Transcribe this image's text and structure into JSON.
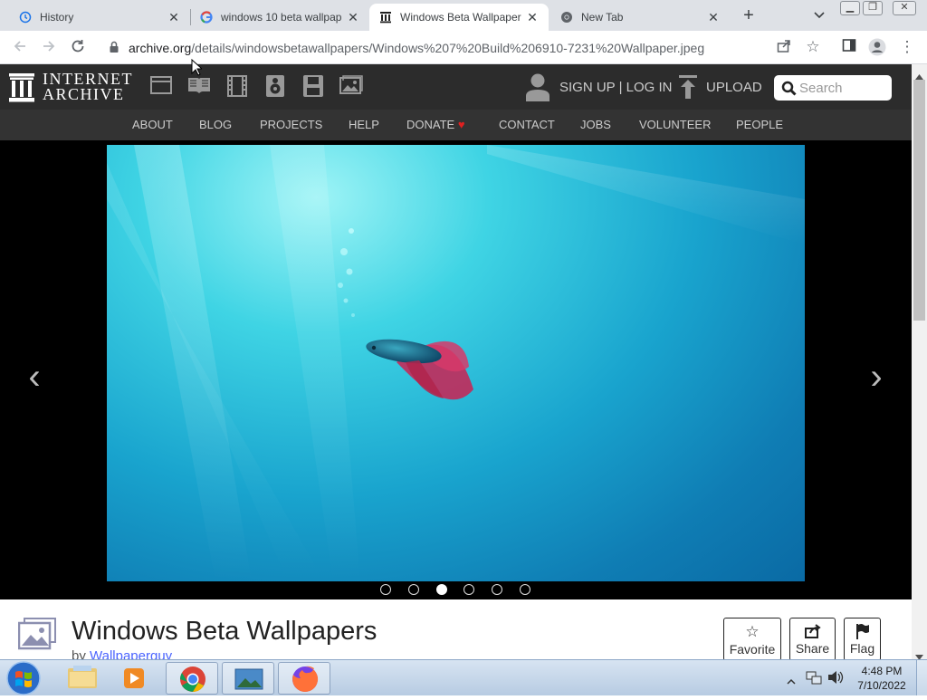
{
  "browser": {
    "tabs": [
      {
        "title": "History",
        "icon": "history-icon",
        "active": false
      },
      {
        "title": "windows 10 beta wallpap",
        "icon": "google-icon",
        "active": false
      },
      {
        "title": "Windows Beta Wallpaper",
        "icon": "archive-icon",
        "active": true
      },
      {
        "title": "New Tab",
        "icon": "chrome-icon",
        "active": false
      }
    ],
    "url_host": "archive.org",
    "url_path": "/details/windowsbetawallpapers/Windows%207%20Build%206910-7231%20Wallpaper.jpeg"
  },
  "ia_header": {
    "logo_line1": "INTERNET",
    "logo_line2": "ARCHIVE",
    "signin": "SIGN UP | LOG IN",
    "upload": "UPLOAD",
    "search_placeholder": "Search",
    "media_icons": [
      "web-icon",
      "texts-icon",
      "video-icon",
      "audio-icon",
      "software-icon",
      "images-icon"
    ]
  },
  "ia_nav": {
    "items": [
      "ABOUT",
      "BLOG",
      "PROJECTS",
      "HELP",
      "DONATE",
      "CONTACT",
      "JOBS",
      "VOLUNTEER",
      "PEOPLE"
    ],
    "donate_heart": "♥"
  },
  "viewer": {
    "prev": "‹",
    "next": "›",
    "slide_count": 6,
    "active_slide": 3
  },
  "item": {
    "title": "Windows Beta Wallpapers",
    "by_prefix": "by",
    "author": "Wallpaperguy",
    "actions": [
      {
        "label": "Favorite",
        "icon": "star-icon",
        "glyph": "☆"
      },
      {
        "label": "Share",
        "icon": "share-icon",
        "glyph": "⇪"
      },
      {
        "label": "Flag",
        "icon": "flag-icon",
        "glyph": "⚑"
      }
    ]
  },
  "taskbar": {
    "time": "4:48 PM",
    "date": "7/10/2022",
    "apps": [
      "explorer-icon",
      "media-player-icon",
      "chrome-icon",
      "photo-viewer-icon",
      "firefox-icon"
    ]
  },
  "colors": {
    "ia_dark": "#2c2c2c",
    "ia_nav": "#333333",
    "donate_heart": "#e02020",
    "link": "#4b64ff"
  }
}
